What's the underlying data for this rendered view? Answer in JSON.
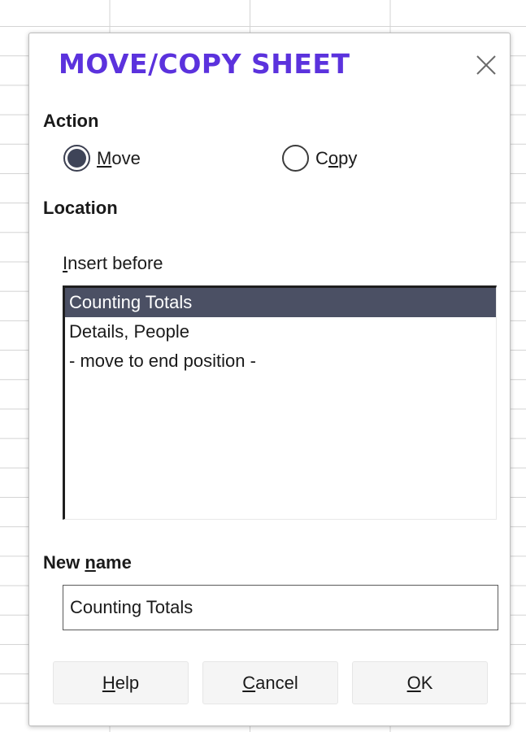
{
  "dialog": {
    "title": "MOVE/COPY SHEET",
    "close_icon": "close-icon"
  },
  "action": {
    "label": "Action",
    "options": [
      {
        "mnemonic": "M",
        "rest": "ove",
        "selected": true
      },
      {
        "before": "C",
        "mnemonic": "o",
        "rest": "py",
        "selected": false
      }
    ]
  },
  "location": {
    "label": "Location",
    "insert_before": {
      "mnemonic": "I",
      "rest": "nsert before"
    },
    "items": [
      "Counting Totals",
      "Details, People",
      "- move to end position -"
    ],
    "selected_index": 0
  },
  "new_name": {
    "label_before": "New ",
    "mnemonic": "n",
    "label_rest": "ame",
    "value": "Counting Totals"
  },
  "buttons": {
    "help": {
      "mnemonic": "H",
      "rest": "elp"
    },
    "cancel": {
      "mnemonic": "C",
      "rest": "ancel"
    },
    "ok": {
      "mnemonic": "O",
      "rest": "K"
    }
  },
  "colors": {
    "title": "#5b32dd",
    "selection": "#4b5064",
    "radio_dot": "#3e4458"
  }
}
